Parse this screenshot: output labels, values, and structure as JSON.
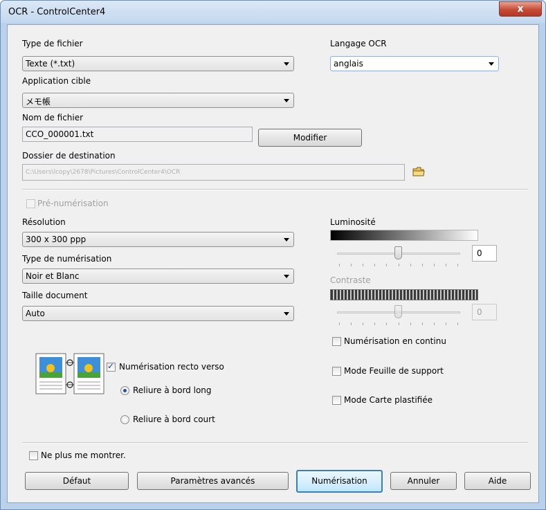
{
  "window": {
    "title": "OCR - ControlCenter4",
    "close_glyph": "x"
  },
  "file_type": {
    "label": "Type de fichier",
    "value": "Texte (*.txt)"
  },
  "ocr_language": {
    "label": "Langage OCR",
    "value": "anglais"
  },
  "target_app": {
    "label": "Application cible",
    "value": "メモ帳"
  },
  "file_name": {
    "label": "Nom de fichier",
    "value": "CCO_000001.txt",
    "modify_button": "Modifier"
  },
  "destination": {
    "label": "Dossier de destination",
    "value": "C:\\Users\\lcopy\\2678\\Pictures\\ControlCenter4\\OCR",
    "folder_icon": "folder-icon"
  },
  "prescan": {
    "label": "Pré-numérisation",
    "checked": false,
    "enabled": false
  },
  "resolution": {
    "label": "Résolution",
    "value": "300 x 300 ppp"
  },
  "scan_type": {
    "label": "Type de numérisation",
    "value": "Noir et Blanc"
  },
  "doc_size": {
    "label": "Taille document",
    "value": "Auto"
  },
  "brightness": {
    "label": "Luminosité",
    "value": "0"
  },
  "contrast": {
    "label": "Contraste",
    "value": "0",
    "enabled": false
  },
  "duplex": {
    "label": "Numérisation recto verso",
    "checked": true,
    "long_edge": {
      "label": "Reliure à bord long",
      "selected": true
    },
    "short_edge": {
      "label": "Reliure à bord court",
      "selected": false
    }
  },
  "options": {
    "continuous": "Numérisation en continu",
    "carrier_sheet": "Mode Feuille de support",
    "plastic_card": "Mode Carte plastifiée"
  },
  "dont_show": "Ne plus me montrer.",
  "buttons": {
    "default": "Défaut",
    "advanced": "Paramètres avancés",
    "scan": "Numérisation",
    "cancel": "Annuler",
    "help": "Aide"
  },
  "colors": {
    "title_bar": "#c4d8ee",
    "close": "#c74a35",
    "accent": "#3c7fb1"
  }
}
